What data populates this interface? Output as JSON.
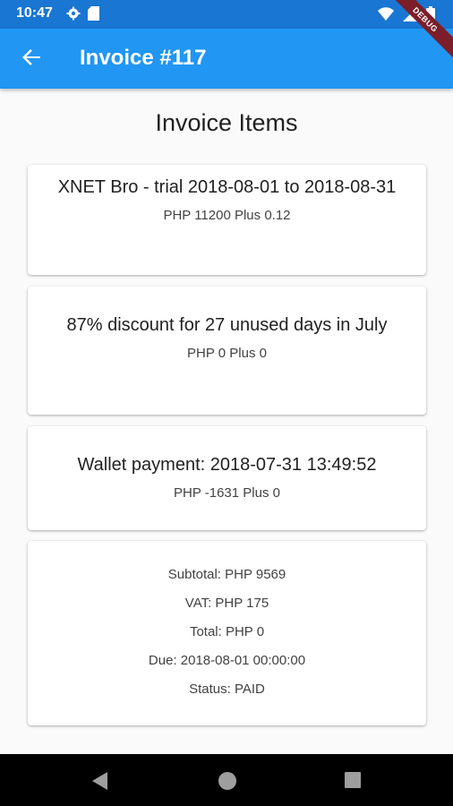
{
  "status_bar": {
    "time": "10:47",
    "debug_label": "DEBUG",
    "icons": [
      "gear-icon",
      "sd-card-icon",
      "wifi-icon",
      "cellular-signal-icon",
      "battery-icon"
    ]
  },
  "app_bar": {
    "title": "Invoice #117",
    "back_icon": "arrow-back-icon",
    "background": "#2196f3"
  },
  "page": {
    "heading": "Invoice Items"
  },
  "items": [
    {
      "title": "XNET Bro - trial 2018-08-01 to 2018-08-31",
      "amount": "PHP 11200 Plus 0.12"
    },
    {
      "title": "87% discount for 27 unused days in July",
      "amount": "PHP 0 Plus 0"
    },
    {
      "title": "Wallet payment: 2018-07-31 13:49:52",
      "amount": "PHP -1631 Plus 0"
    }
  ],
  "summary": {
    "subtotal": "Subtotal: PHP 9569",
    "vat": "VAT: PHP 175",
    "total": "Total: PHP 0",
    "due": "Due: 2018-08-01 00:00:00",
    "status": "Status: PAID"
  },
  "nav_bar": {
    "icons": [
      "back-triangle-icon",
      "home-circle-icon",
      "recents-square-icon"
    ]
  }
}
